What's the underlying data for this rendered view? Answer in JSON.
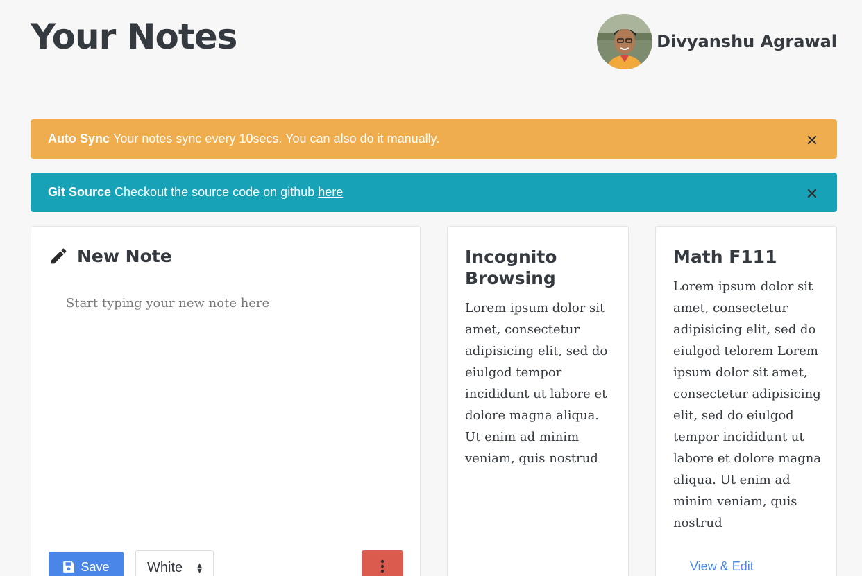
{
  "header": {
    "title": "Your Notes",
    "user_name": "Divyanshu Agrawal"
  },
  "alerts": [
    {
      "title": "Auto Sync",
      "text": "Your notes sync every 10secs. You can also do it manually.",
      "close_icon": "close-icon",
      "color": "#f0ad4e"
    },
    {
      "title": "Git Source",
      "text": "Checkout the source code on github",
      "link_text": "here",
      "close_icon": "close-icon",
      "color": "#17a2b8"
    }
  ],
  "new_note": {
    "title": "New Note",
    "icon": "pencil-icon",
    "placeholder": "Start typing your new note here",
    "save_label": "Save",
    "save_icon": "floppy-disk-icon",
    "color_value": "White",
    "more_icon": "vertical-ellipsis-icon"
  },
  "notes": [
    {
      "title": "Incognito Browsing",
      "body": "Lorem ipsum dolor sit amet, consectetur adipisicing elit, sed do eiulgod tempor incididunt ut labore et dolore magna aliqua. Ut enim ad minim veniam, quis nostrud"
    },
    {
      "title": "Math F111",
      "body": "Lorem ipsum dolor sit amet, consectetur adipisicing elit, sed do eiulgod telorem Lorem ipsum dolor sit amet, consectetur adipisicing elit, sed do eiulgod tempor incididunt ut labore et dolore magna aliqua. Ut enim ad minim veniam, quis nostrud",
      "link": "View & Edit"
    }
  ],
  "colors": {
    "save_button": "#4a86e8",
    "more_button": "#dc5b4f",
    "link": "#4a86e8"
  }
}
